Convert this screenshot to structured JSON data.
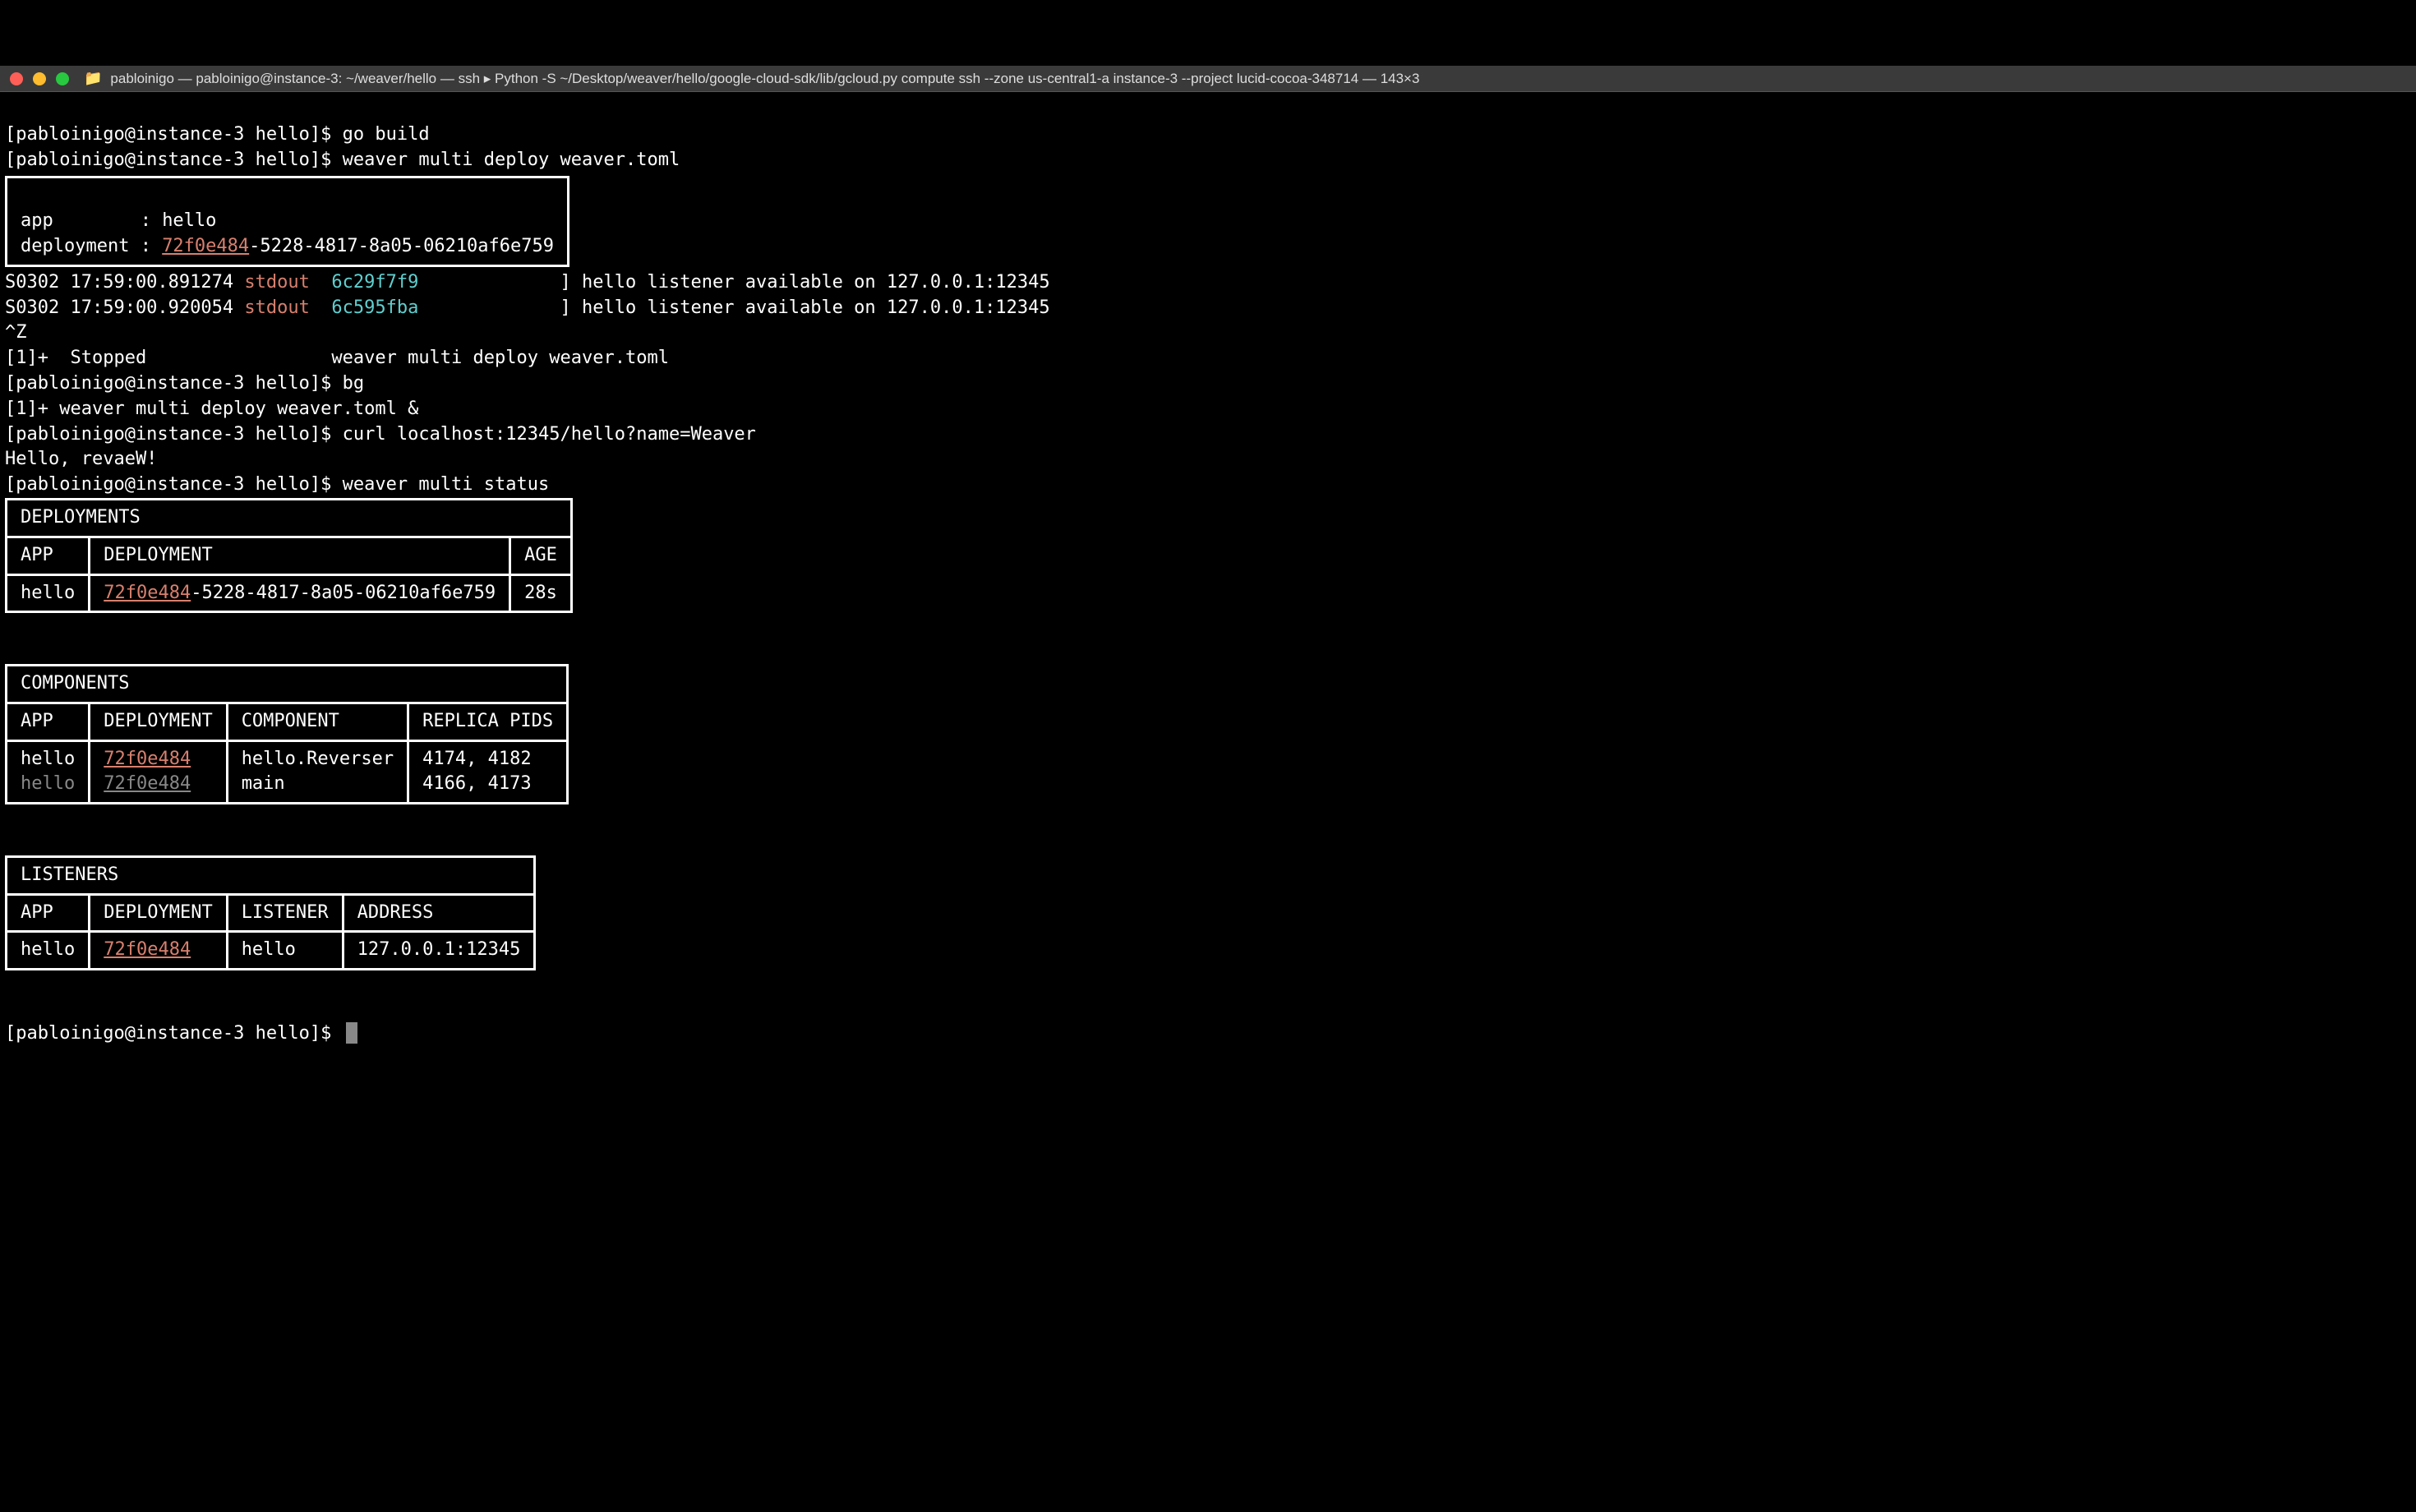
{
  "titlebar": {
    "title": "pabloinigo — pabloinigo@instance-3: ~/weaver/hello — ssh ▸ Python -S ~/Desktop/weaver/hello/google-cloud-sdk/lib/gcloud.py compute ssh --zone us-central1-a instance-3 --project lucid-cocoa-348714 — 143×3"
  },
  "prompts": {
    "p1": "[pabloinigo@instance-3 hello]$ ",
    "cmds": {
      "build": "go build",
      "deploy": "weaver multi deploy weaver.toml",
      "bg": "bg",
      "curl": "curl localhost:12345/hello?name=Weaver",
      "status": "weaver multi status"
    }
  },
  "deploy_box": {
    "app_label": "app        : ",
    "app_value": "hello",
    "deploy_label": "deployment : ",
    "deploy_id_short": "72f0e484",
    "deploy_id_rest": "-5228-4817-8a05-06210af6e759"
  },
  "logs": {
    "l1_prefix": "S0302 17:59:00.891274 ",
    "l1_stdout": "stdout",
    "l1_hash": "6c29f7f9",
    "l1_bracket": "             ] ",
    "l1_msg": "hello listener available on 127.0.0.1:12345",
    "l2_prefix": "S0302 17:59:00.920054 ",
    "l2_stdout": "stdout",
    "l2_hash": "6c595fba",
    "l2_bracket": "             ] ",
    "l2_msg": "hello listener available on 127.0.0.1:12345",
    "ctrlz": "^Z",
    "stopped": "[1]+  Stopped                 weaver multi deploy weaver.toml",
    "bg_out": "[1]+ weaver multi deploy weaver.toml &",
    "curl_out": "Hello, revaeW!"
  },
  "deployments": {
    "title": "DEPLOYMENTS",
    "headers": {
      "app": "APP",
      "deployment": "DEPLOYMENT",
      "age": "AGE"
    },
    "rows": [
      {
        "app": "hello",
        "deployment_short": "72f0e484",
        "deployment_rest": "-5228-4817-8a05-06210af6e759",
        "age": "28s"
      }
    ]
  },
  "components": {
    "title": "COMPONENTS",
    "headers": {
      "app": "APP",
      "deployment": "DEPLOYMENT",
      "component": "COMPONENT",
      "pids": "REPLICA PIDS"
    },
    "rows": [
      {
        "app": "hello",
        "deployment": "72f0e484",
        "component": "hello.Reverser",
        "pids": "4174, 4182"
      },
      {
        "app": "hello",
        "deployment": "72f0e484",
        "component": "main",
        "pids": "4166, 4173"
      }
    ]
  },
  "listeners": {
    "title": "LISTENERS",
    "headers": {
      "app": "APP",
      "deployment": "DEPLOYMENT",
      "listener": "LISTENER",
      "address": "ADDRESS"
    },
    "rows": [
      {
        "app": "hello",
        "deployment": "72f0e484",
        "listener": "hello",
        "address": "127.0.0.1:12345"
      }
    ]
  }
}
